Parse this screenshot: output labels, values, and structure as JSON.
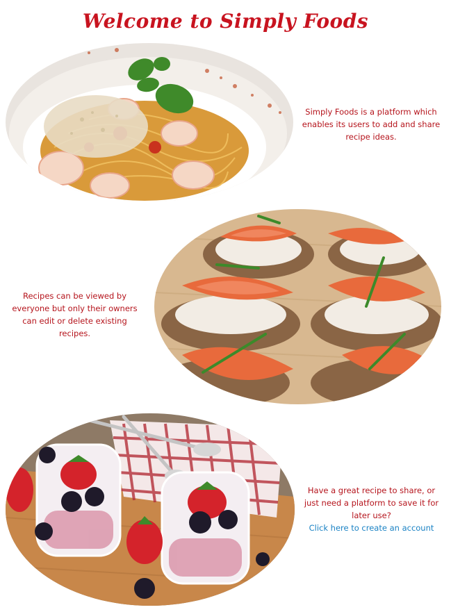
{
  "page": {
    "title": "Welcome to Simply Foods"
  },
  "sections": [
    {
      "image": "pasta-with-shrimp-image",
      "text": "Simply Foods is a platform which enables its users to add and share recipe ideas."
    },
    {
      "image": "salmon-canapes-image",
      "text": "Recipes can be viewed by everyone but only their owners can edit or delete existing recipes."
    },
    {
      "image": "berry-dessert-image",
      "text": "Have a great recipe to share, or just need a platform to save it for later use?",
      "link": "Click here to create an account"
    }
  ],
  "colors": {
    "title": "#c8131f",
    "body_text": "#b5141c",
    "link": "#1a82c4",
    "background": "#ffffff"
  }
}
